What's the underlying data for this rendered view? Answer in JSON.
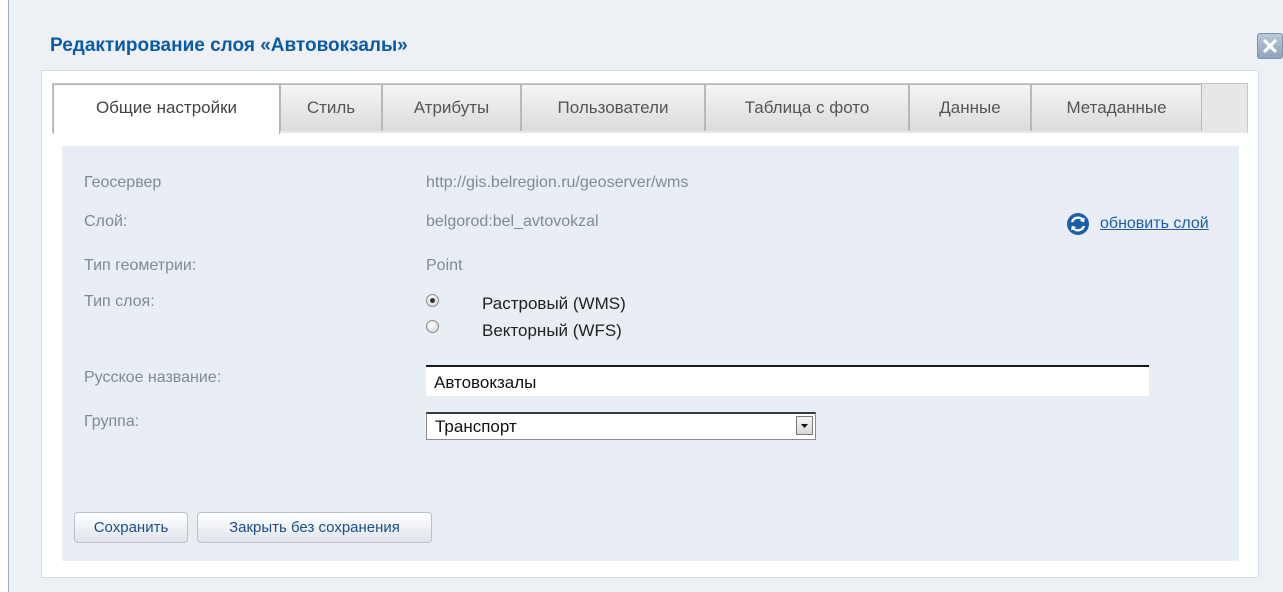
{
  "dialog": {
    "title": "Редактирование слоя «Автовокзалы»",
    "close_icon": "close-icon"
  },
  "tabs": [
    {
      "label": "Общие настройки",
      "active": true
    },
    {
      "label": "Стиль",
      "active": false
    },
    {
      "label": "Атрибуты",
      "active": false
    },
    {
      "label": "Пользователи",
      "active": false
    },
    {
      "label": "Таблица с фото",
      "active": false
    },
    {
      "label": "Данные",
      "active": false
    },
    {
      "label": "Метаданные",
      "active": false
    }
  ],
  "form": {
    "geoserver_label": "Геосервер",
    "geoserver_value": "http://gis.belregion.ru/geoserver/wms",
    "layer_label": "Слой:",
    "layer_value": "belgorod:bel_avtovokzal",
    "refresh_link": "обновить слой",
    "geometry_label": "Тип геометрии:",
    "geometry_value": "Point",
    "layer_type_label": "Тип слоя:",
    "layer_type_options": [
      {
        "label": "Растровый (WMS)",
        "selected": true
      },
      {
        "label": "Векторный (WFS)",
        "selected": false
      }
    ],
    "russian_name_label": "Русское название:",
    "russian_name_value": "Автовокзалы",
    "group_label": "Группа:",
    "group_value": "Транспорт"
  },
  "buttons": {
    "save": "Сохранить",
    "close_without_save": "Закрыть без сохранения"
  },
  "colors": {
    "title": "#0b5aa8",
    "link": "#1a5ea8",
    "content_bg": "#e8eef4",
    "dialog_bg": "#edf1f6"
  }
}
